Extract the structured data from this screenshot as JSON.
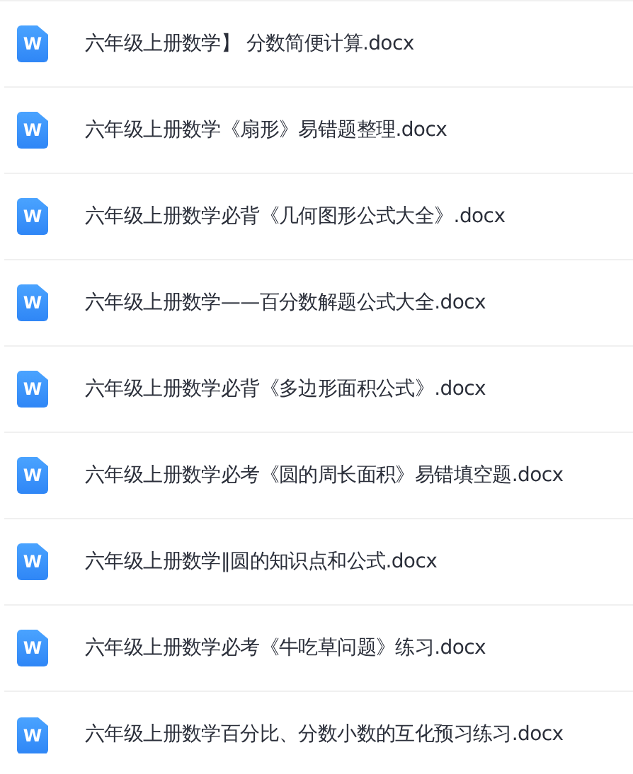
{
  "files": [
    {
      "name": "六年级上册数学】 分数简便计算.docx",
      "icon_letter": "W"
    },
    {
      "name": "六年级上册数学《扇形》易错题整理.docx",
      "icon_letter": "W"
    },
    {
      "name": "六年级上册数学必背《几何图形公式大全》.docx",
      "icon_letter": "W"
    },
    {
      "name": "六年级上册数学——百分数解题公式大全.docx",
      "icon_letter": "W"
    },
    {
      "name": "六年级上册数学必背《多边形面积公式》.docx",
      "icon_letter": "W"
    },
    {
      "name": "六年级上册数学必考《圆的周长面积》易错填空题.docx",
      "icon_letter": "W"
    },
    {
      "name": "六年级上册数学‖圆的知识点和公式.docx",
      "icon_letter": "W"
    },
    {
      "name": "六年级上册数学必考《牛吃草问题》练习.docx",
      "icon_letter": "W"
    },
    {
      "name": "六年级上册数学百分比、分数小数的互化预习练习.docx",
      "icon_letter": "W"
    }
  ]
}
